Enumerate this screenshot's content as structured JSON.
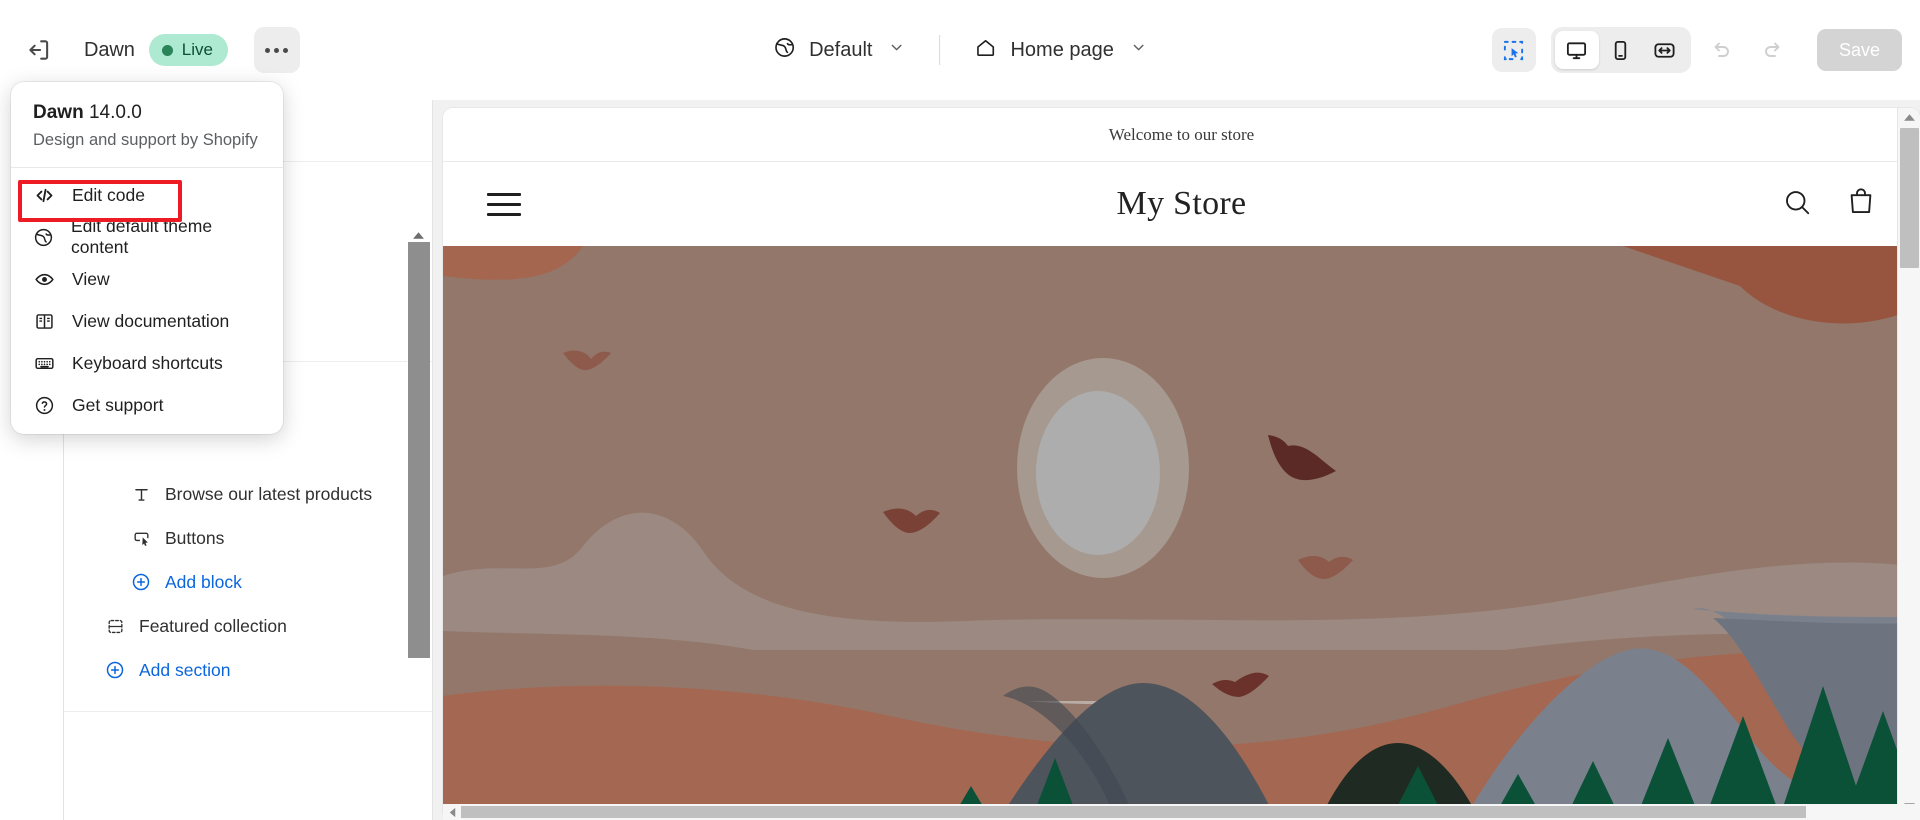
{
  "topbar": {
    "exit_icon": "exit-arrow-icon",
    "theme_name": "Dawn",
    "status_badge": "Live",
    "more_button": "more-options",
    "market_selector": {
      "icon": "globe-icon",
      "label": "Default"
    },
    "page_selector": {
      "icon": "home-icon",
      "label": "Home page"
    },
    "tools": {
      "select_tool": "inspector-select-icon",
      "devices": [
        {
          "name": "desktop",
          "icon": "desktop-icon",
          "active": true
        },
        {
          "name": "mobile",
          "icon": "mobile-icon",
          "active": false
        },
        {
          "name": "fullscreen",
          "icon": "fullscreen-icon",
          "active": false
        }
      ],
      "undo": "undo-icon",
      "redo": "redo-icon"
    },
    "save_label": "Save"
  },
  "popover": {
    "title_bold": "Dawn",
    "version": "14.0.0",
    "subtitle": "Design and support by Shopify",
    "items": [
      {
        "label": "Edit code",
        "icon": "code-icon",
        "highlighted": true
      },
      {
        "label": "Edit default theme content",
        "icon": "globe-icon"
      },
      {
        "label": "View",
        "icon": "eye-icon"
      },
      {
        "label": "View documentation",
        "icon": "book-icon"
      },
      {
        "label": "Keyboard shortcuts",
        "icon": "keyboard-icon"
      },
      {
        "label": "Get support",
        "icon": "question-circle-icon"
      }
    ],
    "highlight_color": "#ED1C24"
  },
  "sidebar": {
    "rows": [
      {
        "label": "Browse our latest products",
        "icon": "text-icon",
        "type": "block"
      },
      {
        "label": "Buttons",
        "icon": "button-icon",
        "type": "block"
      },
      {
        "label": "Add block",
        "icon": "plus-circle-icon",
        "type": "action"
      },
      {
        "label": "Featured collection",
        "icon": "section-icon",
        "type": "section"
      },
      {
        "label": "Add section",
        "icon": "plus-circle-icon",
        "type": "action"
      }
    ]
  },
  "preview": {
    "announcement": "Welcome to our store",
    "store_title": "My Store",
    "header_icons": {
      "menu": "hamburger-icon",
      "search": "search-icon",
      "cart": "cart-icon"
    },
    "hero": {
      "colors": {
        "sky_tan": "#93776A",
        "sky_tan_light": "#9B8378",
        "terracotta": "#A5664F",
        "terracotta_dark": "#97543E",
        "band_grey": "#9C8C85",
        "sun_ring": "#A69990",
        "sun_core": "#ADADAD",
        "mountain_grey": "#7B818C",
        "mountain_dark": "#4E545C",
        "pine_green": "#0B5138",
        "bird_dark": "#5C2A26",
        "bird_mid": "#8D5A4C"
      }
    }
  },
  "colors": {
    "accent_blue": "#0B66DD",
    "live_badge_bg": "#AEE9D1",
    "live_badge_dot": "#29845A",
    "save_disabled": "#D4D4D4"
  }
}
